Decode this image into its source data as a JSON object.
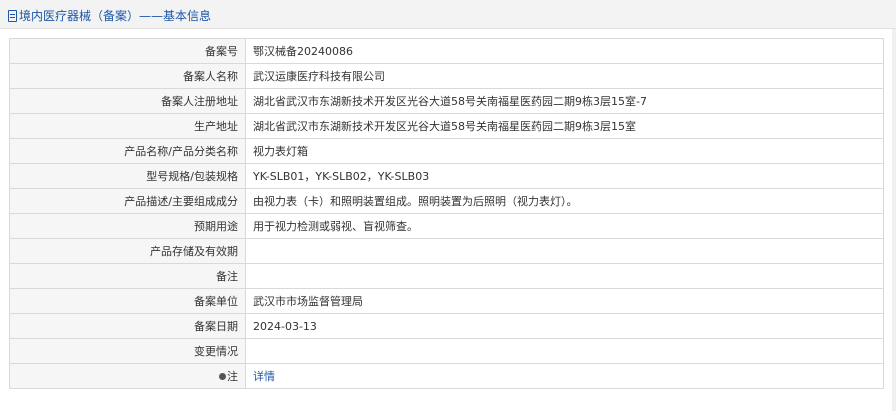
{
  "header": {
    "title": "境内医疗器械（备案）——基本信息",
    "icon": "document-icon"
  },
  "rows": [
    {
      "label": "备案号",
      "value": "鄂汉械备20240086"
    },
    {
      "label": "备案人名称",
      "value": "武汉运康医疗科技有限公司"
    },
    {
      "label": "备案人注册地址",
      "value": "湖北省武汉市东湖新技术开发区光谷大道58号关南福星医药园二期9栋3层15室-7"
    },
    {
      "label": "生产地址",
      "value": "湖北省武汉市东湖新技术开发区光谷大道58号关南福星医药园二期9栋3层15室"
    },
    {
      "label": "产品名称/产品分类名称",
      "value": "视力表灯箱"
    },
    {
      "label": "型号规格/包装规格",
      "value": "YK-SLB01，YK-SLB02，YK-SLB03"
    },
    {
      "label": "产品描述/主要组成成分",
      "value": "由视力表（卡）和照明装置组成。照明装置为后照明（视力表灯）。"
    },
    {
      "label": "预期用途",
      "value": "用于视力检测或弱视、盲视筛查。"
    },
    {
      "label": "产品存储及有效期",
      "value": ""
    },
    {
      "label": "备注",
      "value": ""
    },
    {
      "label": "备案单位",
      "value": "武汉市市场监督管理局"
    },
    {
      "label": "备案日期",
      "value": "2024-03-13"
    },
    {
      "label": "变更情况",
      "value": ""
    }
  ],
  "note": {
    "label": "注",
    "icon": "pin-icon",
    "link_text": "详情"
  },
  "colors": {
    "accent": "#1c57a6",
    "label_bg": "#f6f6f6",
    "header_bg": "#f3f3f3",
    "border": "#d9d9d9"
  }
}
